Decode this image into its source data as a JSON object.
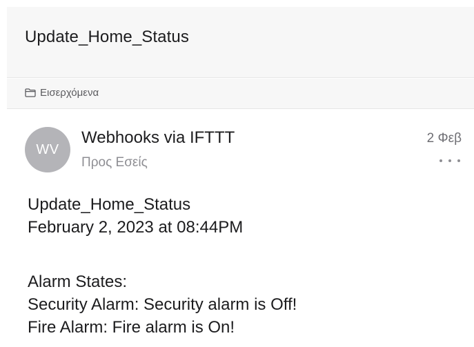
{
  "email": {
    "subject": "Update_Home_Status",
    "folder": {
      "label": "Εισερχόμενα",
      "icon": "folder-icon"
    },
    "sender": {
      "initials": "WV",
      "name": "Webhooks via IFTTT",
      "recipients": "Προς Εσείς",
      "date": "2 Φεβ"
    },
    "more_icon": "more-horizontal-icon",
    "body": {
      "heading": "Update_Home_Status",
      "timestamp": "February 2, 2023 at 08:44PM",
      "section_title": "Alarm States:",
      "security_alarm": "Security Alarm: Security alarm is Off!",
      "fire_alarm": "Fire Alarm: Fire alarm is On!"
    }
  },
  "colors": {
    "header_bg": "#f7f7f7",
    "avatar_bg": "#b4b4b8",
    "text_primary": "#1c1c1e",
    "text_secondary": "#8e8e93"
  }
}
